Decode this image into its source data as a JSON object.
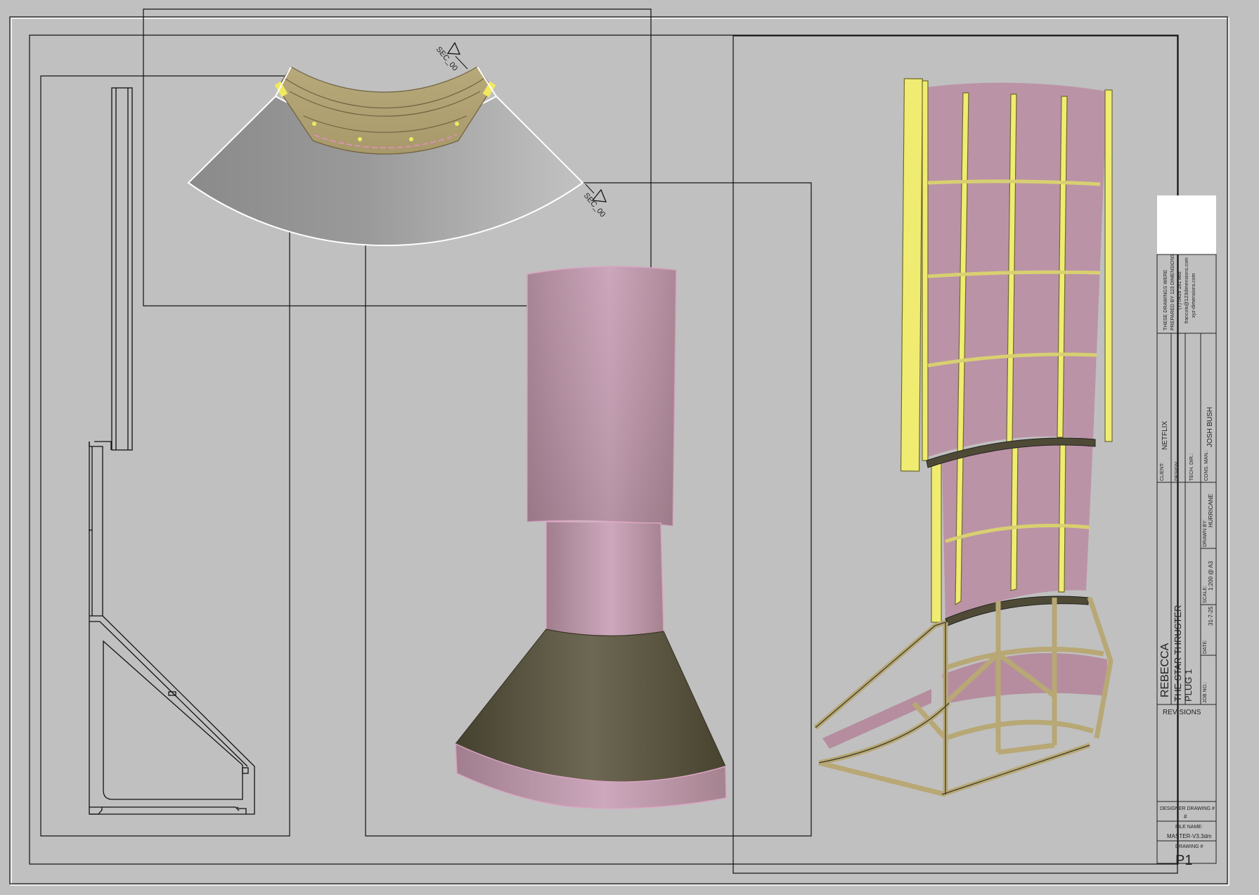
{
  "drawing": {
    "section_markers": [
      "SEC_00",
      "SEC_00"
    ]
  },
  "title_block": {
    "prepared_note": [
      "THESE DRAWINGS WERE",
      "PREPARED BY 123 DIMENSIONS",
      "(T) 0416 181 865",
      "francois@123dimensions.com",
      "xyz-dimensions.com"
    ],
    "client_label": "CLIENT:",
    "client_value": "NETFLIX",
    "design_label": "DESIGN:",
    "tech_dir_label": "TECH. DIR.:",
    "cons_man_label": "CONS. MAN.:",
    "cons_man_value": "JOSH BUSH",
    "drawn_by_label": "DRAWN BY:",
    "drawn_by_value": "HURRICANE",
    "scale_label": "SCALE:",
    "scale_value": "1:200 @ A3",
    "date_label": "DATE:",
    "date_value": "31-7-25",
    "job_no_label": "JOB NO.:",
    "project": "REBECCA",
    "title": "THE STAR THRUSTER",
    "subtitle": "PLUG 1",
    "revisions_label": "REVISIONS",
    "designer_drawing_label": "DESIGNER DRAWING #",
    "designer_drawing_value": "#",
    "file_name_label": "FILE NAME:",
    "file_name_value": "MASTER-V3.3dm",
    "drawing_no_label": "DRAWING #",
    "drawing_no_value": "P1"
  },
  "colors": {
    "background": "#c0c0c0",
    "pink": "#b8909f",
    "dark_olive": "#4f4a36",
    "khaki": "#b5a97e",
    "yellow": "#ecea6c",
    "grey_wedge": "#9a9a9a"
  }
}
